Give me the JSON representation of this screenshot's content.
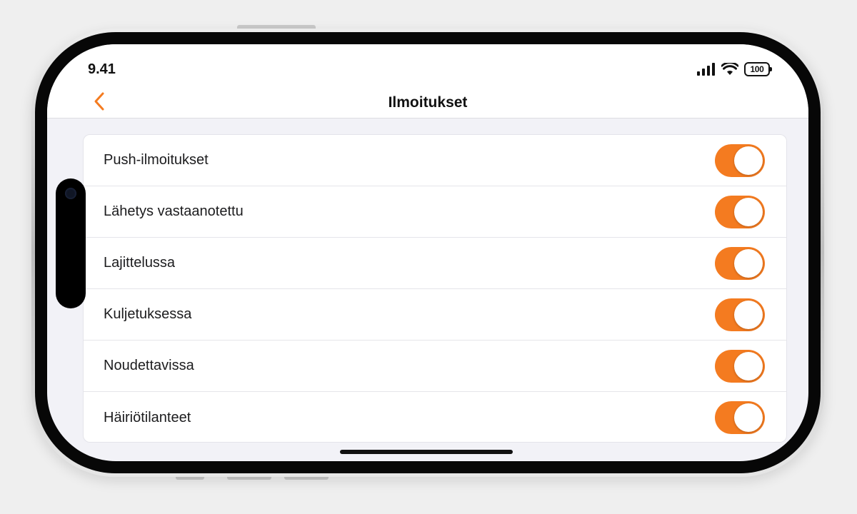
{
  "colors": {
    "accent": "#f47b20",
    "screen_background": "#f2f2f7",
    "frame": "#070707"
  },
  "status_bar": {
    "time": "9.41",
    "battery": "100",
    "icons": [
      "cellular-signal-icon",
      "wifi-icon",
      "battery-icon"
    ]
  },
  "nav": {
    "back_icon": "chevron-left-icon",
    "title": "Ilmoitukset"
  },
  "settings": {
    "items": [
      {
        "label": "Push-ilmoitukset",
        "enabled": true
      },
      {
        "label": "Lähetys vastaanotettu",
        "enabled": true
      },
      {
        "label": "Lajittelussa",
        "enabled": true
      },
      {
        "label": "Kuljetuksessa",
        "enabled": true
      },
      {
        "label": "Noudettavissa",
        "enabled": true
      },
      {
        "label": "Häiriötilanteet",
        "enabled": true
      }
    ]
  }
}
